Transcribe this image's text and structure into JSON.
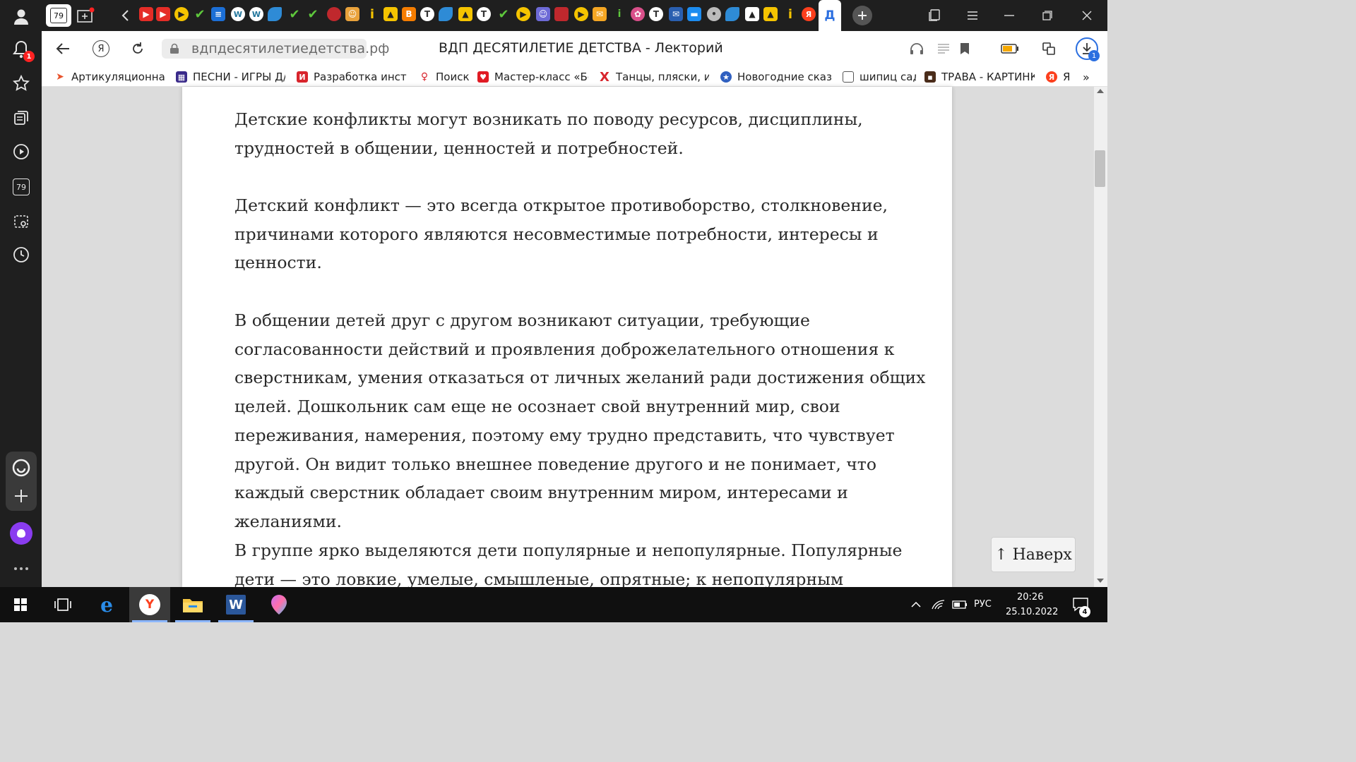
{
  "sidebar": {
    "notification_badge": "1",
    "counter_label": "79"
  },
  "tabbar": {
    "counter_label": "79"
  },
  "addressbar": {
    "url": "вдпдесятилетиедетства.рф",
    "title": "ВДП ДЕСЯТИЛЕТИЕ ДЕТСТВА - Лекторий",
    "download_badge": "1"
  },
  "bookmarks": [
    {
      "label": "Артикуляционная"
    },
    {
      "label": "ПЕСНИ - ИГРЫ Д/"
    },
    {
      "label": "Разработка инстр"
    },
    {
      "label": "Поиск"
    },
    {
      "label": "Мастер-класс «Бо"
    },
    {
      "label": "Танцы, пляски, иг"
    },
    {
      "label": "Новогодние сказк"
    },
    {
      "label": "шипиц сад"
    },
    {
      "label": "ТРАВА - КАРТИНК"
    },
    {
      "label": "Я"
    }
  ],
  "article": {
    "paragraphs": [
      "Детские конфликты могут возникать по поводу ресурсов, дисциплины, трудностей в общении, ценностей и потребностей.",
      "Детский конфликт — это всегда открытое противоборство, столкновение, причинами которого являются несовместимые потребности, интересы и ценности.",
      "В общении детей друг с другом возникают ситуации, требующие согласованности действий и проявления доброжелательного отношения к сверстникам, умения отказаться от личных желаний ради достижения общих целей. Дошкольник сам еще не осознает свой внутренний мир, свои переживания, намерения, поэтому ему трудно представить, что чувствует другой. Он видит только внешнее поведение другого и не понимает, что каждый сверстник обладает своим внутренним миром, интересами и желаниями.",
      "В группе ярко выделяются дети популярные и непопулярные. Популярные дети — это ловкие, умелые, смышленые, опрятные; к непопулярным"
    ],
    "to_top_label": "↑ Наверх"
  },
  "taskbar": {
    "language": "РУС",
    "time": "20:26",
    "date": "25.10.2022",
    "notifications": "4",
    "word_label": "W"
  },
  "colors": {
    "dark_chrome": "#1f1f1f",
    "yandex_red": "#fc3f1d",
    "accent_blue": "#2b6fe0",
    "alice_purple": "#8a3cf0"
  }
}
